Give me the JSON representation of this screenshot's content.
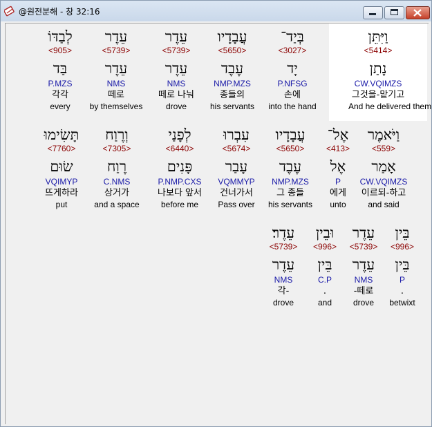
{
  "window": {
    "title": "@원전분해 - 창 32:16"
  },
  "rows": [
    [
      {
        "heb": "וַיִּתֵּן",
        "strong": "<5414>",
        "lemma": "נָתַן",
        "morph": "CW.VQIMZS",
        "korean": "그것을-맡기고",
        "english": "And he delivered them"
      },
      {
        "heb": "בְּיַד־",
        "strong": "<3027>",
        "lemma": "יָד",
        "morph": "P.NFSG",
        "korean": "손에",
        "english": "into the hand"
      },
      {
        "heb": "עֲבָדָיו",
        "strong": "<5650>",
        "lemma": "עֶבֶד",
        "morph": "NMP.MZS",
        "korean": "종들의",
        "english": "his servants"
      },
      {
        "heb": "עֵדֶר",
        "strong": "<5739>",
        "lemma": "עֵדֶר",
        "morph": "NMS",
        "korean": "떼로 나눠",
        "english": "drove"
      },
      {
        "heb": "עֵדֶר",
        "strong": "<5739>",
        "lemma": "עֵדֶר",
        "morph": "NMS",
        "korean": "떼로",
        "english": "by themselves"
      },
      {
        "heb": "לְבַדּוֹ",
        "strong": "<905>",
        "lemma": "בַּד",
        "morph": "P.MZS",
        "korean": "각각",
        "english": "every"
      }
    ],
    [
      {
        "heb": "וַיֹּאמֶר",
        "strong": "<559>",
        "lemma": "אָמַר",
        "morph": "CW.VQIMZS",
        "korean": "이르되-하고",
        "english": "and said"
      },
      {
        "heb": "אֶל־",
        "strong": "<413>",
        "lemma": "אֶל",
        "morph": "P",
        "korean": "에게",
        "english": "unto"
      },
      {
        "heb": "עֲבָדָיו",
        "strong": "<5650>",
        "lemma": "עֶבֶד",
        "morph": "NMP.MZS",
        "korean": "그 종들",
        "english": "his servants"
      },
      {
        "heb": "עִבְרוּ",
        "strong": "<5674>",
        "lemma": "עָבַר",
        "morph": "VQMMYP",
        "korean": "건너가서",
        "english": "Pass over"
      },
      {
        "heb": "לְפָנַי",
        "strong": "<6440>",
        "lemma": "פָּנִים",
        "morph": "P.NMP.CXS",
        "korean": "나보다 앞서",
        "english": "before me"
      },
      {
        "heb": "וְרֶוַח",
        "strong": "<7305>",
        "lemma": "רֶוַח",
        "morph": "C.NMS",
        "korean": "상거가",
        "english": "and a space"
      },
      {
        "heb": "תָּשִׂימוּ",
        "strong": "<7760>",
        "lemma": "שׂוּם",
        "morph": "VQIMYP",
        "korean": "뜨게하라",
        "english": "put"
      }
    ],
    [
      {
        "heb": "בֵּין",
        "strong": "<996>",
        "lemma": "בֵּין",
        "morph": "P",
        "korean": ".",
        "english": "betwixt"
      },
      {
        "heb": "עֵדֶר",
        "strong": "<5739>",
        "lemma": "עֵדֶר",
        "morph": "NMS",
        "korean": "-떼로",
        "english": "drove"
      },
      {
        "heb": "וּבֵין",
        "strong": "<996>",
        "lemma": "בֵּין",
        "morph": "C.P",
        "korean": ".",
        "english": "and"
      },
      {
        "heb": "עֵדֶר׃",
        "strong": "<5739>",
        "lemma": "עֵדֶר",
        "morph": "NMS",
        "korean": "각-",
        "english": "drove"
      }
    ]
  ]
}
